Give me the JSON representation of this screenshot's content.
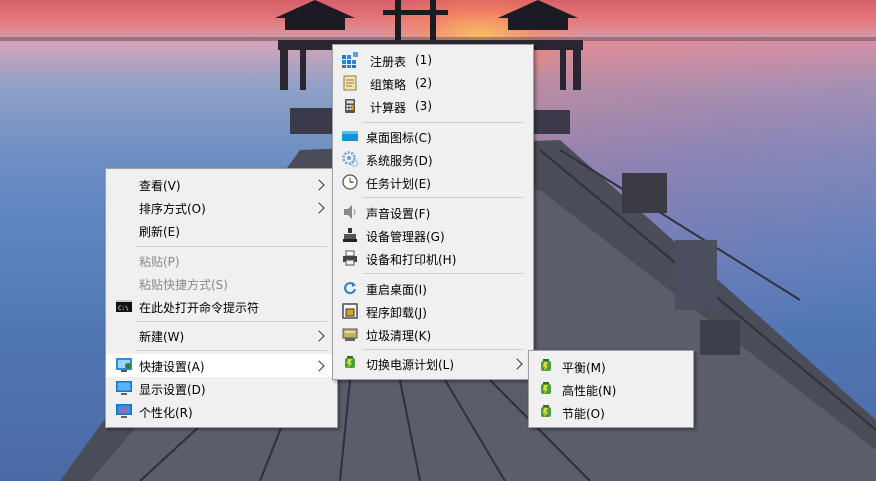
{
  "colors": {
    "menu_bg": "#f0f0f0",
    "menu_border": "#a0a0a0",
    "highlight": "#ffffff",
    "disabled_text": "#8a8a8a",
    "sky_top": "#d6606a",
    "sea": "#5c83c0"
  },
  "context_menu": {
    "items": [
      {
        "label": "查看(V)",
        "submenu": true
      },
      {
        "label": "排序方式(O)",
        "submenu": true
      },
      {
        "label": "刷新(E)"
      },
      {
        "label": "粘贴(P)",
        "disabled": true
      },
      {
        "label": "粘贴快捷方式(S)",
        "disabled": true
      },
      {
        "label": "在此处打开命令提示符",
        "icon": "cmd-icon"
      },
      {
        "label": "新建(W)",
        "submenu": true
      },
      {
        "label": "快捷设置(A)",
        "icon": "settings-shortcut-icon",
        "submenu": true,
        "highlighted": true
      },
      {
        "label": "显示设置(D)",
        "icon": "monitor-icon"
      },
      {
        "label": "个性化(R)",
        "icon": "personalize-icon"
      }
    ]
  },
  "quick_settings_menu": {
    "items": [
      {
        "label": "注册表",
        "key": "(1)",
        "icon": "registry-icon"
      },
      {
        "label": "组策略",
        "key": "(2)",
        "icon": "group-policy-icon"
      },
      {
        "label": "计算器",
        "key": "(3)",
        "icon": "calculator-icon"
      },
      {
        "label": "桌面图标(C)",
        "icon": "desktop-icon"
      },
      {
        "label": "系统服务(D)",
        "icon": "services-gear-icon"
      },
      {
        "label": "任务计划(E)",
        "icon": "clock-icon"
      },
      {
        "label": "声音设置(F)",
        "icon": "speaker-icon"
      },
      {
        "label": "设备管理器(G)",
        "icon": "device-manager-icon"
      },
      {
        "label": "设备和打印机(H)",
        "icon": "printer-icon"
      },
      {
        "label": "重启桌面(I)",
        "icon": "restart-icon"
      },
      {
        "label": "程序卸载(J)",
        "icon": "uninstall-icon"
      },
      {
        "label": "垃圾清理(K)",
        "icon": "cleanup-icon"
      },
      {
        "label": "切换电源计划(L)",
        "icon": "power-plan-icon",
        "submenu": true
      }
    ]
  },
  "power_plan_menu": {
    "items": [
      {
        "label": "平衡(M)",
        "icon": "power-plan-icon"
      },
      {
        "label": "高性能(N)",
        "icon": "power-plan-icon"
      },
      {
        "label": "节能(O)",
        "icon": "power-plan-icon"
      }
    ]
  }
}
